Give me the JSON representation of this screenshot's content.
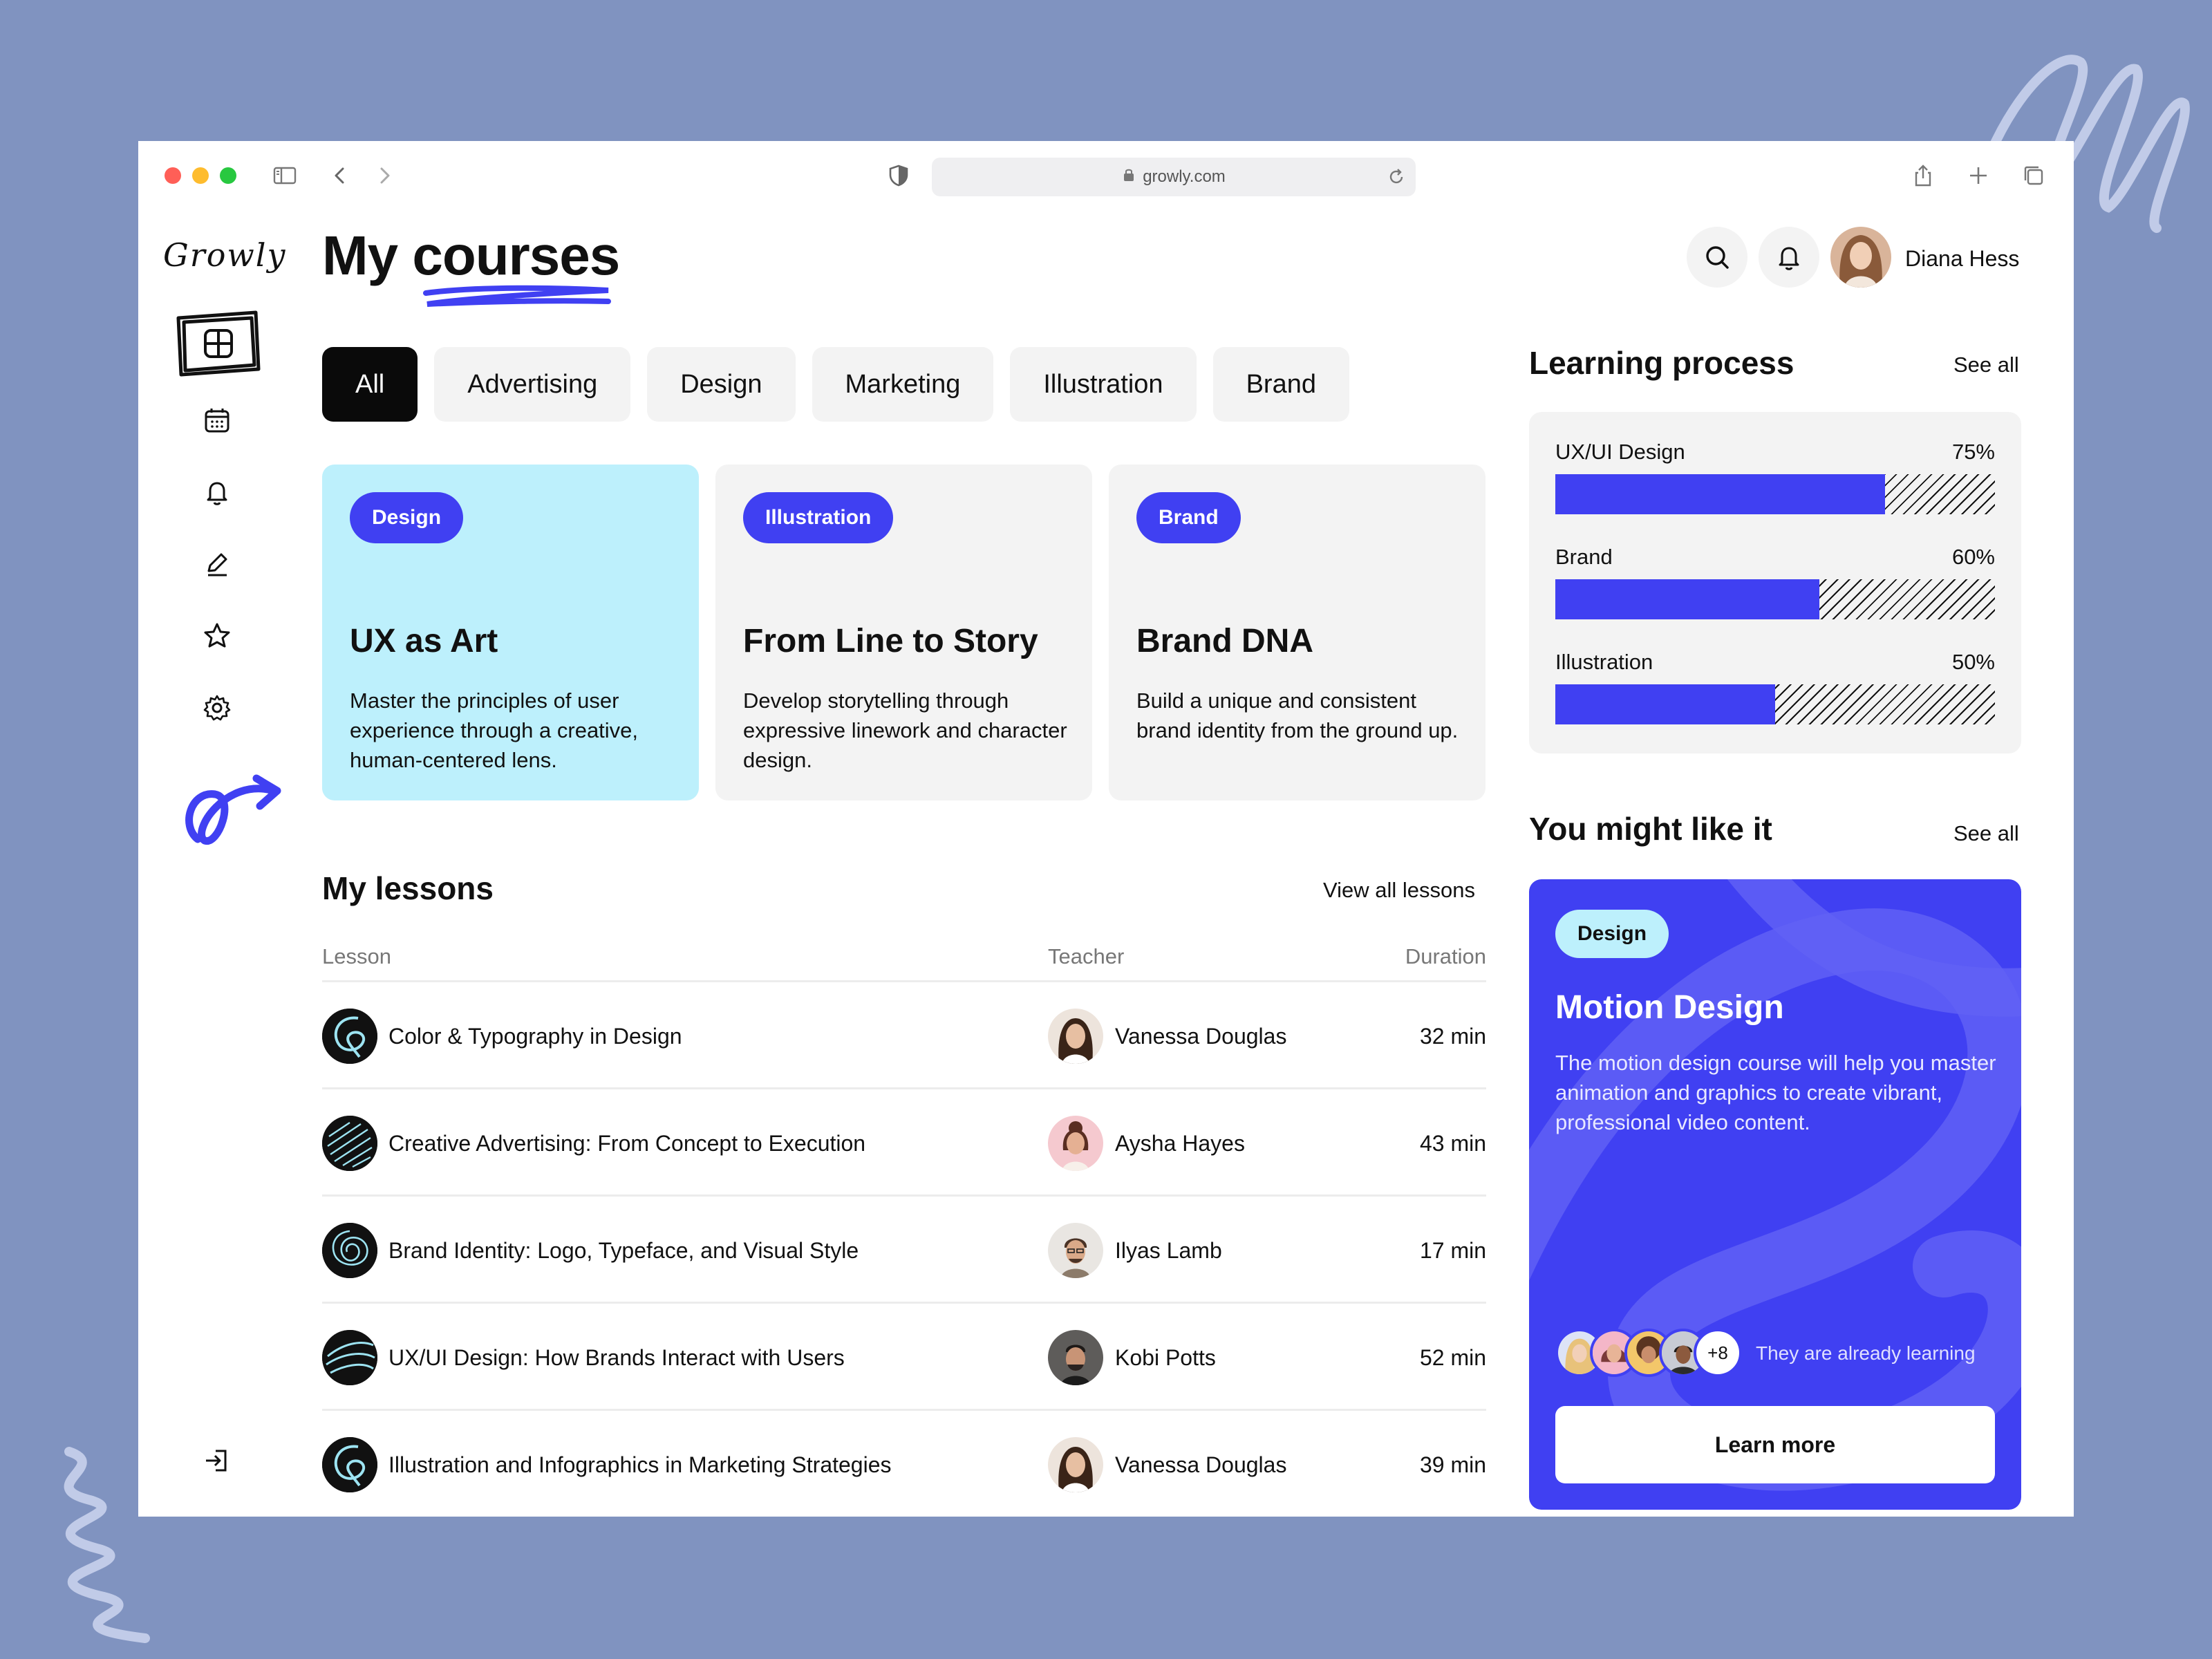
{
  "browser": {
    "url": "growly.com"
  },
  "sidebar": {
    "logo": "Growly",
    "items": [
      {
        "name": "dashboard",
        "icon": "dashboard-icon"
      },
      {
        "name": "calendar",
        "icon": "calendar-icon"
      },
      {
        "name": "notifications",
        "icon": "bell-icon"
      },
      {
        "name": "edit",
        "icon": "pencil-icon"
      },
      {
        "name": "favorites",
        "icon": "star-icon"
      },
      {
        "name": "settings",
        "icon": "gear-icon"
      }
    ],
    "logout_icon": "logout-icon"
  },
  "header": {
    "title_prefix": "My",
    "title_highlight": "courses",
    "user_name": "Diana Hess"
  },
  "filters": [
    "All",
    "Advertising",
    "Design",
    "Marketing",
    "Illustration",
    "Brand"
  ],
  "courses": [
    {
      "badge": "Design",
      "title": "UX as Art",
      "description": "Master the principles of user experience through a creative, human-centered lens."
    },
    {
      "badge": "Illustration",
      "title": "From Line to Story",
      "description": "Develop storytelling through expressive linework and character design."
    },
    {
      "badge": "Brand",
      "title": "Brand DNA",
      "description": "Build a unique and consistent brand identity from the ground up."
    }
  ],
  "lessons": {
    "title": "My lessons",
    "view_all": "View all lessons",
    "columns": {
      "lesson": "Lesson",
      "teacher": "Teacher",
      "duration": "Duration"
    },
    "rows": [
      {
        "lesson": "Color & Typography in Design",
        "teacher": "Vanessa Douglas",
        "duration": "32 min"
      },
      {
        "lesson": "Creative Advertising: From Concept to Execution",
        "teacher": "Aysha Hayes",
        "duration": "43 min"
      },
      {
        "lesson": "Brand Identity: Logo, Typeface, and Visual Style",
        "teacher": "Ilyas Lamb",
        "duration": "17 min"
      },
      {
        "lesson": "UX/UI Design: How Brands Interact with Users",
        "teacher": "Kobi Potts",
        "duration": "52 min"
      },
      {
        "lesson": "Illustration and Infographics in Marketing Strategies",
        "teacher": "Vanessa Douglas",
        "duration": "39 min"
      }
    ]
  },
  "learning_process": {
    "title": "Learning process",
    "see_all": "See all",
    "items": [
      {
        "label": "UX/UI Design",
        "percent_text": "75%",
        "value": 0.75
      },
      {
        "label": "Brand",
        "percent_text": "60%",
        "value": 0.6
      },
      {
        "label": "Illustration",
        "percent_text": "50%",
        "value": 0.5
      }
    ]
  },
  "recommendation": {
    "title": "You might like it",
    "see_all": "See all",
    "badge": "Design",
    "course_title": "Motion Design",
    "description": "The motion design course will help you master animation and graphics to create vibrant, professional video content.",
    "extra_count": "+8",
    "learners_text": "They are already learning",
    "button": "Learn more"
  },
  "colors": {
    "accent": "#4040F2",
    "featured_card": "#BDF0FC",
    "background": "#8093C0"
  }
}
